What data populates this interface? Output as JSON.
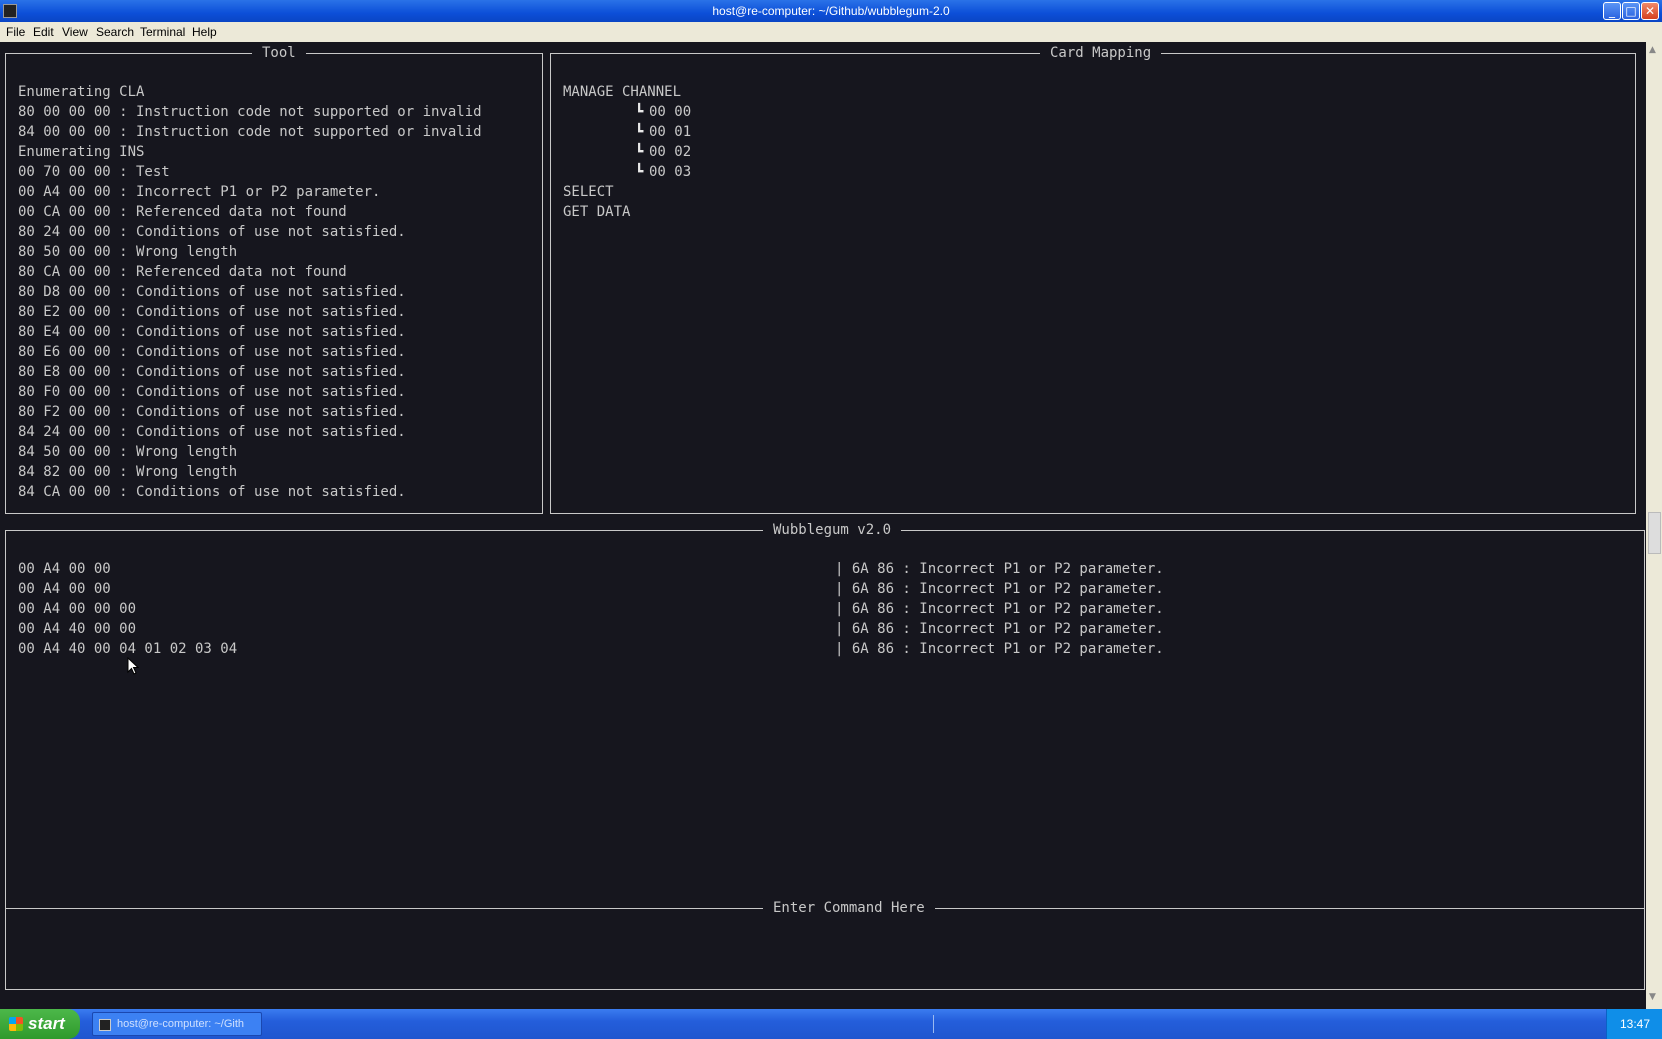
{
  "window": {
    "title": "host@re-computer: ~/Github/wubblegum-2.0",
    "minimize_label": "_",
    "maximize_label": "□",
    "close_label": "✕"
  },
  "menu": [
    "File",
    "Edit",
    "View",
    "Search",
    "Terminal",
    "Help"
  ],
  "tool_panel": {
    "title": "Tool",
    "lines": [
      "Enumerating CLA",
      "80 00 00 00 : Instruction code not supported or invalid",
      "84 00 00 00 : Instruction code not supported or invalid",
      "Enumerating INS",
      "00 70 00 00 : Test",
      "00 A4 00 00 : Incorrect P1 or P2 parameter.",
      "00 CA 00 00 : Referenced data not found",
      "80 24 00 00 : Conditions of use not satisfied.",
      "80 50 00 00 : Wrong length",
      "80 CA 00 00 : Referenced data not found",
      "80 D8 00 00 : Conditions of use not satisfied.",
      "80 E2 00 00 : Conditions of use not satisfied.",
      "80 E4 00 00 : Conditions of use not satisfied.",
      "80 E6 00 00 : Conditions of use not satisfied.",
      "80 E8 00 00 : Conditions of use not satisfied.",
      "80 F0 00 00 : Conditions of use not satisfied.",
      "80 F2 00 00 : Conditions of use not satisfied.",
      "84 24 00 00 : Conditions of use not satisfied.",
      "84 50 00 00 : Wrong length",
      "84 82 00 00 : Wrong length",
      "84 CA 00 00 : Conditions of use not satisfied."
    ]
  },
  "card_mapping": {
    "title": "Card Mapping",
    "manage_channel": "MANAGE CHANNEL",
    "branch_glyph": "┗",
    "channels": [
      "00 00",
      "00 01",
      "00 02",
      "00 03"
    ],
    "select": "SELECT",
    "get_data": "GET DATA"
  },
  "main_panel": {
    "title": "Wubblegum v2.0",
    "rows": [
      {
        "cmd": "00 A4 00 00",
        "resp": "| 6A 86 : Incorrect P1 or P2 parameter."
      },
      {
        "cmd": "00 A4 00 00",
        "resp": "| 6A 86 : Incorrect P1 or P2 parameter."
      },
      {
        "cmd": "00 A4 00 00 00",
        "resp": "| 6A 86 : Incorrect P1 or P2 parameter."
      },
      {
        "cmd": "00 A4 40 00 00",
        "resp": "| 6A 86 : Incorrect P1 or P2 parameter."
      },
      {
        "cmd": "00 A4 40 00 04 01 02 03 04",
        "resp": "| 6A 86 : Incorrect P1 or P2 parameter."
      }
    ]
  },
  "command_panel": {
    "title": "Enter Command Here",
    "value": ""
  },
  "taskbar": {
    "start_label": "start",
    "task_label": "host@re-computer: ~/Gith",
    "clock": "13:47"
  }
}
